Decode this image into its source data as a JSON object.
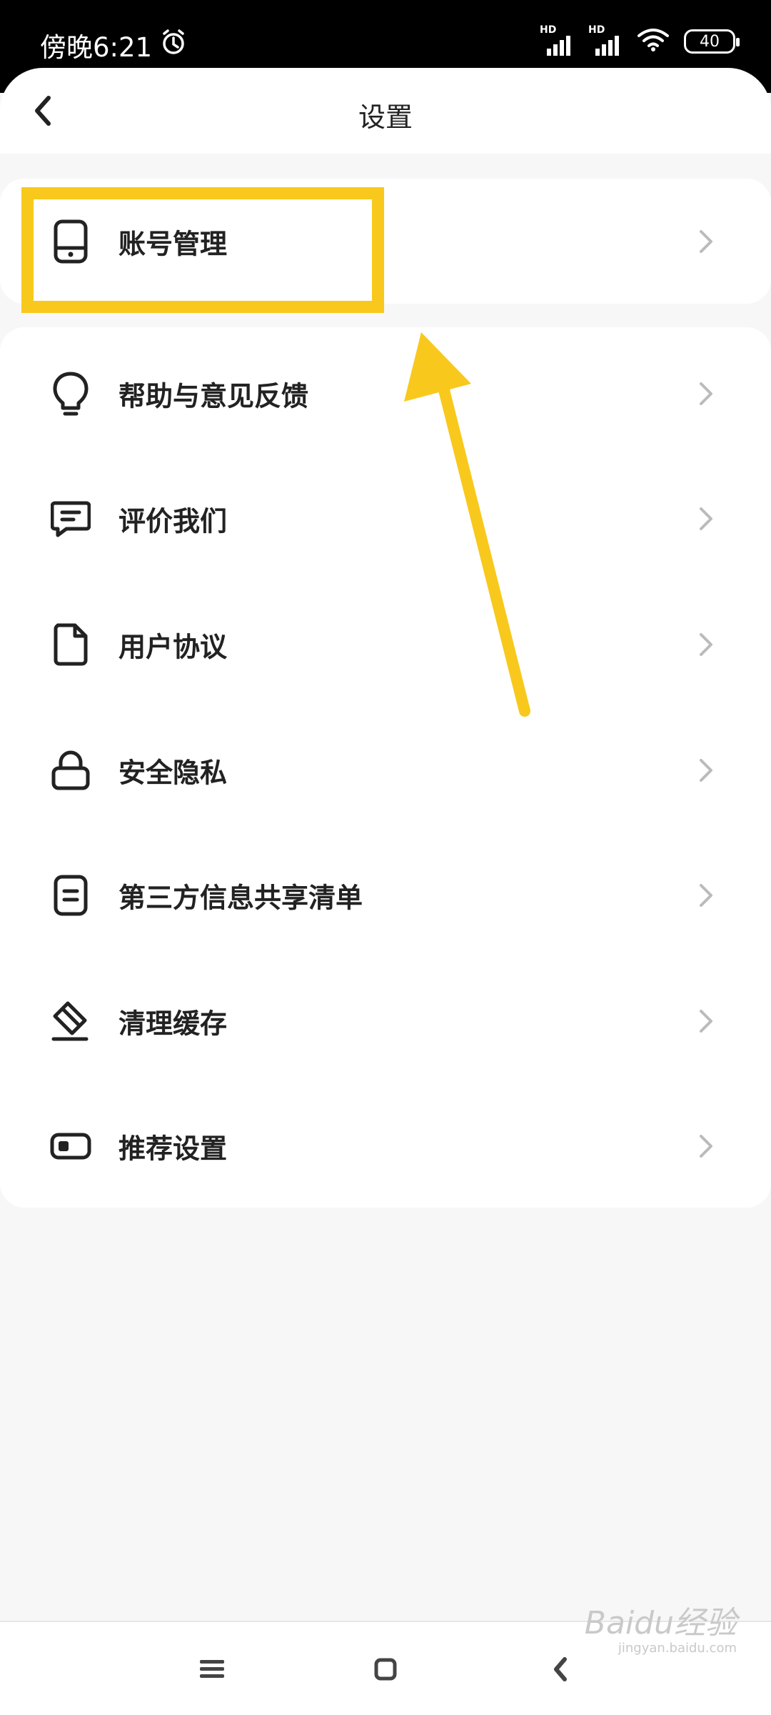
{
  "status_bar": {
    "time": "傍晚6:21",
    "signal1_label": "HD",
    "signal2_label": "HD",
    "battery": "40"
  },
  "header": {
    "title": "设置"
  },
  "account_group": {
    "items": [
      {
        "label": "账号管理",
        "icon": "phone-icon"
      }
    ]
  },
  "settings_group": {
    "items": [
      {
        "label": "帮助与意见反馈",
        "icon": "lightbulb-icon"
      },
      {
        "label": "评价我们",
        "icon": "message-icon"
      },
      {
        "label": "用户协议",
        "icon": "document-icon"
      },
      {
        "label": "安全隐私",
        "icon": "lock-icon"
      },
      {
        "label": "第三方信息共享清单",
        "icon": "list-icon"
      },
      {
        "label": "清理缓存",
        "icon": "eraser-icon"
      },
      {
        "label": "推荐设置",
        "icon": "toggle-icon"
      }
    ]
  },
  "annotation": {
    "highlight_color": "#f8c91c"
  },
  "watermark": {
    "brand": "Baidu经验",
    "url": "jingyan.baidu.com"
  }
}
